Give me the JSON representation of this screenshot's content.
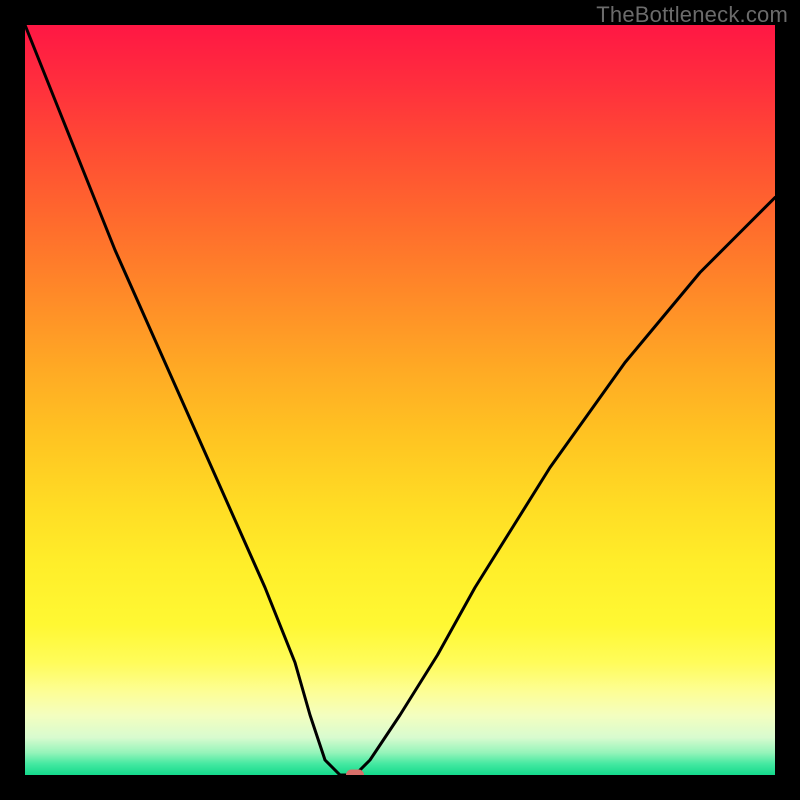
{
  "watermark": "TheBottleneck.com",
  "colors": {
    "frame": "#000000",
    "watermark": "#6b6b6b",
    "curve": "#000000",
    "marker": "#d86f6a",
    "gradient_top": "#ff1744",
    "gradient_bottom": "#14d98c"
  },
  "chart_data": {
    "type": "line",
    "title": "",
    "xlabel": "",
    "ylabel": "",
    "xlim": [
      0,
      100
    ],
    "ylim": [
      0,
      100
    ],
    "grid": false,
    "series": [
      {
        "name": "bottleneck-curve",
        "x": [
          0,
          4,
          8,
          12,
          16,
          20,
          24,
          28,
          32,
          36,
          38,
          40,
          42,
          44,
          46,
          50,
          55,
          60,
          65,
          70,
          75,
          80,
          85,
          90,
          95,
          100
        ],
        "y": [
          100,
          90,
          80,
          70,
          61,
          52,
          43,
          34,
          25,
          15,
          8,
          2,
          0,
          0,
          2,
          8,
          16,
          25,
          33,
          41,
          48,
          55,
          61,
          67,
          72,
          77
        ]
      }
    ],
    "annotations": [
      {
        "name": "optimal-marker",
        "x": 44,
        "y": 0
      }
    ]
  }
}
